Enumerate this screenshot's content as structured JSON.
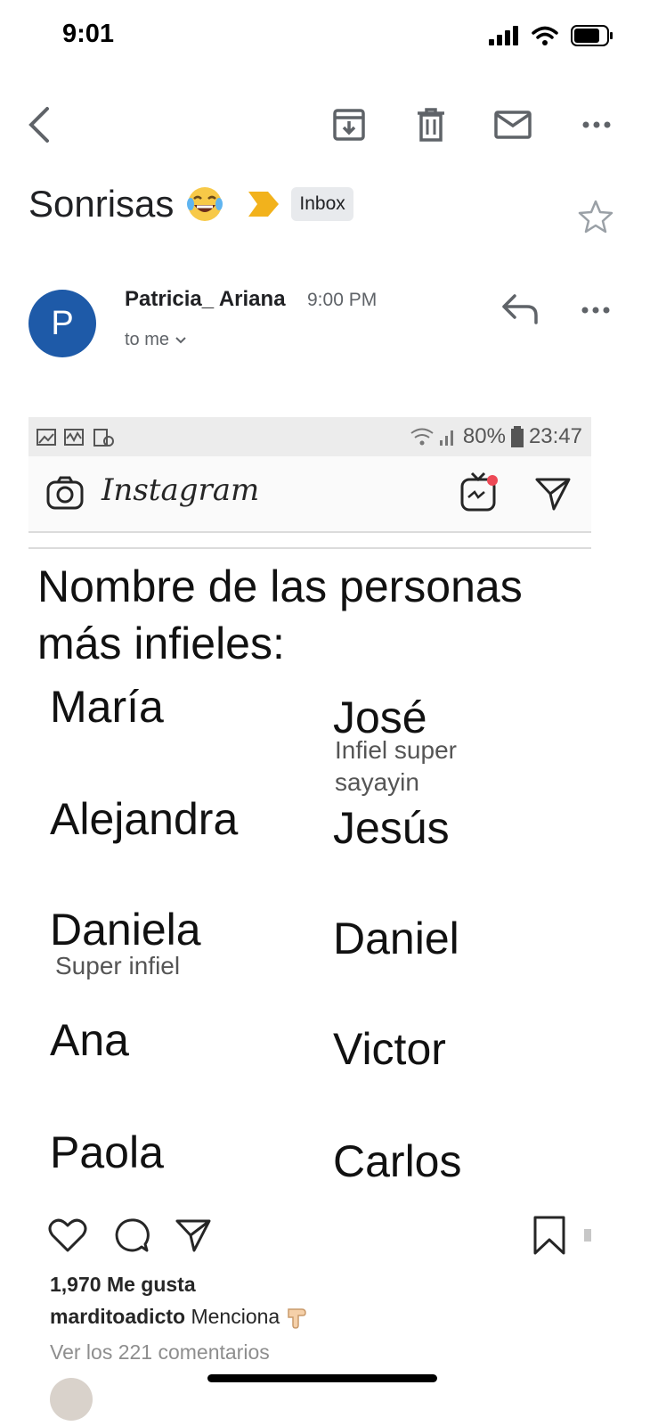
{
  "status_bar": {
    "time": "9:01"
  },
  "toolbar": {
    "back_icon": "chevron-left-icon",
    "actions": [
      "archive-icon",
      "trash-icon",
      "mail-icon",
      "more-icon"
    ]
  },
  "email": {
    "subject": "Sonrisas",
    "subject_emoji": "laughing-tears-emoji",
    "label": "Inbox",
    "sender_initial": "P",
    "sender": "Patricia_ Ariana",
    "time": "9:00 PM",
    "recipient": "to me"
  },
  "attachment": {
    "android_status": {
      "battery": "80%",
      "time": "23:47"
    },
    "app_name": "Instagram",
    "post_text": "Nombre de las personas más infieles:",
    "names_left": [
      "María",
      "Alejandra",
      "Daniela",
      "Ana",
      "Paola"
    ],
    "names_right": [
      "José",
      "Jesús",
      "Daniel",
      "Victor",
      "Carlos"
    ],
    "note_jose": "Infiel super sayayin",
    "note_daniela": "Super infiel",
    "likes": "1,970 Me gusta",
    "caption_user": "marditoadicto",
    "caption_text": "Menciona",
    "comments_link": "Ver los 221 comentarios"
  },
  "colors": {
    "avatar": "#1e5aa8",
    "important_marker": "#f2b21c",
    "chip": "#e8eaed"
  }
}
